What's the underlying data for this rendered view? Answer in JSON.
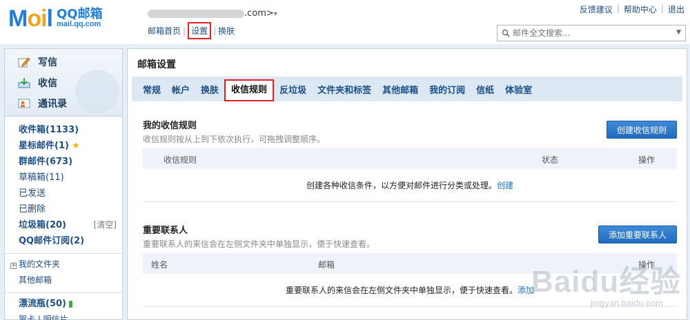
{
  "header": {
    "logo_text_a": "M",
    "logo_text_b": "oi",
    "logo_text_c": "l",
    "logo_cn": "QQ邮箱",
    "logo_url": "mail.qq.com",
    "account_suffix": ".com>",
    "caret": "▾",
    "nav": [
      "邮箱首页",
      "设置",
      "换肤"
    ],
    "links": [
      "反馈建议",
      "帮助中心",
      "退出"
    ],
    "search_placeholder": "邮件全文搜索..."
  },
  "sidebar": {
    "actions": [
      "写信",
      "收信",
      "通讯录"
    ],
    "folders": [
      {
        "label": "收件箱(1133)",
        "bold": true
      },
      {
        "label": "星标邮件(1)",
        "bold": true
      },
      {
        "label": "群邮件(673)",
        "bold": true
      },
      {
        "label": "草稿箱(11)",
        "bold": false
      },
      {
        "label": "已发送",
        "bold": false
      },
      {
        "label": "已删除",
        "bold": false
      },
      {
        "label": "垃圾箱(20)",
        "bold": true,
        "extra": "[清空]"
      },
      {
        "label": "QQ邮件订阅(2)",
        "bold": true
      }
    ],
    "my_folders": "我的文件夹",
    "other_mail": "其他邮箱",
    "drift_bottle": "漂流瓶(50)",
    "cut_off": "贺卡 | 明信片"
  },
  "main": {
    "title": "邮箱设置",
    "tabs": [
      "常规",
      "帐户",
      "换肤",
      "收信规则",
      "反垃圾",
      "文件夹和标签",
      "其他邮箱",
      "我的订阅",
      "信纸",
      "体验室"
    ],
    "active_tab": "收信规则",
    "rules": {
      "title": "我的收信规则",
      "desc": "收信规则按从上到下依次执行，可拖拽调整顺序。",
      "button": "创建收信规则",
      "headers": [
        "收信规则",
        "状态",
        "操作"
      ],
      "empty_text": "创建各种收信条件，以方便对邮件进行分类或处理。",
      "empty_link": "创建"
    },
    "contacts": {
      "title": "重要联系人",
      "desc": "重要联系人的来信会在左侧文件夹中单独显示，便于快速查看。",
      "button": "添加重要联系人",
      "headers": [
        "姓名",
        "邮箱",
        "操作"
      ],
      "empty_text": "重要联系人的来信会在左侧文件夹中单独显示，便于快速查看。",
      "empty_link": "添加"
    }
  },
  "watermark": {
    "big": "Baidu经验",
    "small": "jingyan.baidu.com"
  },
  "colors": {
    "accent": "#1f6bbf",
    "highlight": "#e02020",
    "link": "#1c4e86"
  }
}
